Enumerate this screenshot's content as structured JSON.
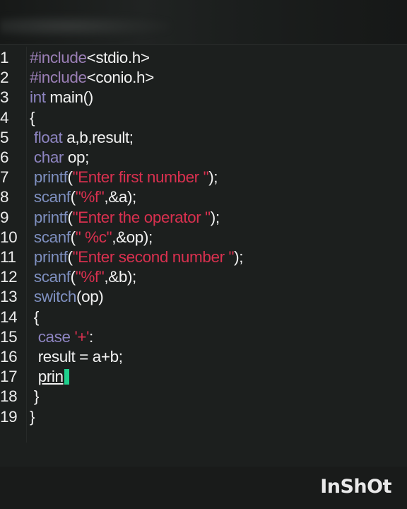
{
  "watermark": "InShOt",
  "editor": {
    "lines": [
      {
        "n": "1",
        "tokens": [
          {
            "t": "#include",
            "c": "kw-pre"
          },
          {
            "t": "<stdio.h>",
            "c": "plain"
          }
        ]
      },
      {
        "n": "2",
        "tokens": [
          {
            "t": "#include",
            "c": "kw-pre"
          },
          {
            "t": "<conio.h>",
            "c": "plain"
          }
        ]
      },
      {
        "n": "3",
        "tokens": [
          {
            "t": "int",
            "c": "kw-type"
          },
          {
            "t": " main()",
            "c": "plain"
          }
        ]
      },
      {
        "n": "4",
        "tokens": [
          {
            "t": "{",
            "c": "plain"
          }
        ]
      },
      {
        "n": "5",
        "tokens": [
          {
            "t": " ",
            "c": "plain"
          },
          {
            "t": "float",
            "c": "kw-type"
          },
          {
            "t": " a,b,result;",
            "c": "plain"
          }
        ]
      },
      {
        "n": "6",
        "tokens": [
          {
            "t": " ",
            "c": "plain"
          },
          {
            "t": "char",
            "c": "kw-type"
          },
          {
            "t": " op;",
            "c": "plain"
          }
        ]
      },
      {
        "n": "7",
        "tokens": [
          {
            "t": " ",
            "c": "plain"
          },
          {
            "t": "printf",
            "c": "kw-fn"
          },
          {
            "t": "(",
            "c": "plain"
          },
          {
            "t": "\"Enter first number \"",
            "c": "str"
          },
          {
            "t": ");",
            "c": "plain"
          }
        ]
      },
      {
        "n": "8",
        "tokens": [
          {
            "t": " ",
            "c": "plain"
          },
          {
            "t": "scanf",
            "c": "kw-fn"
          },
          {
            "t": "(",
            "c": "plain"
          },
          {
            "t": "\"%f\"",
            "c": "str"
          },
          {
            "t": ",&a);",
            "c": "plain"
          }
        ]
      },
      {
        "n": "9",
        "tokens": [
          {
            "t": " ",
            "c": "plain"
          },
          {
            "t": "printf",
            "c": "kw-fn"
          },
          {
            "t": "(",
            "c": "plain"
          },
          {
            "t": "\"Enter the operator \"",
            "c": "str"
          },
          {
            "t": ");",
            "c": "plain"
          }
        ]
      },
      {
        "n": "10",
        "tokens": [
          {
            "t": " ",
            "c": "plain"
          },
          {
            "t": "scanf",
            "c": "kw-fn"
          },
          {
            "t": "(",
            "c": "plain"
          },
          {
            "t": "\" %c\"",
            "c": "str"
          },
          {
            "t": ",&op);",
            "c": "plain"
          }
        ]
      },
      {
        "n": "11",
        "tokens": [
          {
            "t": " ",
            "c": "plain"
          },
          {
            "t": "printf",
            "c": "kw-fn"
          },
          {
            "t": "(",
            "c": "plain"
          },
          {
            "t": "\"Enter second number \"",
            "c": "str"
          },
          {
            "t": ");",
            "c": "plain"
          }
        ]
      },
      {
        "n": "12",
        "tokens": [
          {
            "t": " ",
            "c": "plain"
          },
          {
            "t": "scanf",
            "c": "kw-fn"
          },
          {
            "t": "(",
            "c": "plain"
          },
          {
            "t": "\"%f\"",
            "c": "str"
          },
          {
            "t": ",&b);",
            "c": "plain"
          }
        ]
      },
      {
        "n": "13",
        "tokens": [
          {
            "t": " ",
            "c": "plain"
          },
          {
            "t": "switch",
            "c": "kw-fn"
          },
          {
            "t": "(op)",
            "c": "plain"
          }
        ]
      },
      {
        "n": "14",
        "tokens": [
          {
            "t": " {",
            "c": "plain"
          }
        ]
      },
      {
        "n": "15",
        "tokens": [
          {
            "t": "  ",
            "c": "plain"
          },
          {
            "t": "case",
            "c": "kw-type"
          },
          {
            "t": " ",
            "c": "plain"
          },
          {
            "t": "'+'",
            "c": "str"
          },
          {
            "t": ":",
            "c": "plain"
          }
        ]
      },
      {
        "n": "16",
        "tokens": [
          {
            "t": "  result = a+b;",
            "c": "plain"
          }
        ]
      },
      {
        "n": "17",
        "tokens": [
          {
            "t": "  ",
            "c": "plain"
          },
          {
            "t": "prin",
            "c": "plain underline"
          }
        ],
        "cursor": true
      },
      {
        "n": "18",
        "tokens": [
          {
            "t": " }",
            "c": "plain"
          }
        ]
      },
      {
        "n": "19",
        "tokens": [
          {
            "t": "}",
            "c": "plain"
          }
        ]
      }
    ]
  },
  "colors": {
    "background": "#1c1f1e",
    "preprocessor": "#9b7fb6",
    "type_keyword": "#8d84c0",
    "function": "#7e8fbf",
    "string": "#d9304f",
    "text": "#f2f2f2",
    "cursor": "#1fcf8d"
  }
}
